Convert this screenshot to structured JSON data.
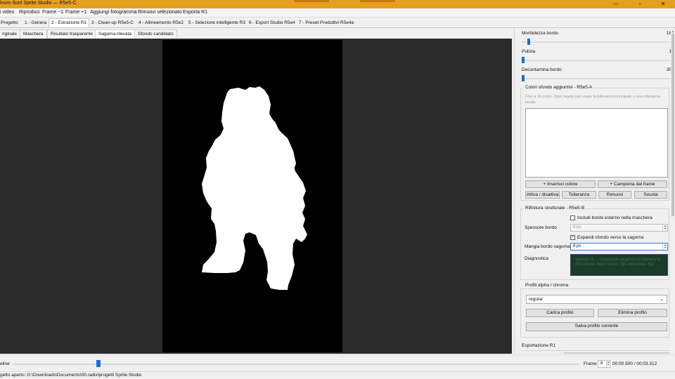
{
  "window": {
    "title": "lnum Sunt Sprite Studio — R5e5-C",
    "controls": [
      "—",
      "▫",
      "✕"
    ]
  },
  "menu": [
    "i video",
    "Riproduci",
    "Frame −1",
    "Frame +1",
    "Aggiungi fotogramma",
    "Rimuovi selezionato",
    "Esporta R1"
  ],
  "step_tabs": [
    {
      "label": "Progetto",
      "active": false
    },
    {
      "label": "1 - Genera",
      "active": false
    },
    {
      "label": "2 - Estrazione R1",
      "active": true
    },
    {
      "label": "3 - Clean-up R5e5-C",
      "active": false
    },
    {
      "label": "4 - Allineamento R5e2",
      "active": false
    },
    {
      "label": "5 - Selezione intelligente R3",
      "active": false
    },
    {
      "label": "6 - Export Studio R5e4",
      "active": false
    },
    {
      "label": "7 - Preset Produttivi R5e4a",
      "active": false
    }
  ],
  "view_tabs": [
    {
      "label": "riginale",
      "active": false
    },
    {
      "label": "Maschera",
      "active": false
    },
    {
      "label": "Risultato trasparente",
      "active": false
    },
    {
      "label": "Sagoma rilevata",
      "active": true
    },
    {
      "label": "Sfondo candidato",
      "active": false
    }
  ],
  "sliders": [
    {
      "label": "Morbidezza bordo",
      "value": 18
    },
    {
      "label": "Pulizia",
      "value": 1
    },
    {
      "label": "Decontamina bordo",
      "value": 35
    }
  ],
  "extra_colors": {
    "title": "Colori sfondo aggiuntivi - R5e5-A",
    "hint": "Fino a 16 colori. Ogni regola può usare la tolleranza principale o una tolleranza locale.",
    "btn_insert": "+ Inserisci colore",
    "btn_sample": "+ Campiona dal frame",
    "btn_toggle": "Attiva / disattiva",
    "btn_tolerance": "Tolleranza",
    "btn_remove": "Rimuovi",
    "btn_clear": "Svuota"
  },
  "refine": {
    "title": "Rifinitura strutturale - R5e5-B",
    "include_edge_label": "Includi bordo esterno nella maschera",
    "include_edge_checked": false,
    "thickness_label": "Spessore bordo",
    "thickness_value": "8 px",
    "expand_label": "Espandi sfondo verso la sagoma",
    "expand_checked": true,
    "eat_label": "Mangia bordo sagoma",
    "eat_value": "8 px",
    "diag_label": "Diagnostica",
    "diag_text": "Sagoma: ok — componente maggiore che interseca la ROI centrale. Bordi: foccato, figli, segmentato, figli."
  },
  "profiles": {
    "title": "Profili alpha / chroma",
    "selected": "regular",
    "btn_load": "Carica profilo",
    "btn_delete": "Elimina profilo",
    "btn_save": "Salva profilo corrente"
  },
  "export_section": "Esportazione R1",
  "timeline": {
    "label": "eline",
    "frame_label": "Frame",
    "frame_value": "8",
    "time": "00:00.500 / 00:03.312",
    "position_fraction": 0.151
  },
  "status": "getto aperto: G:\\Downloads\\Documents\\00.radix\\progetti Sprite Studio",
  "colors": {
    "titlebar": "#e6a020",
    "accent": "#1a70d0",
    "mask_bg": "#000000",
    "silhouette": "#ffffff"
  }
}
